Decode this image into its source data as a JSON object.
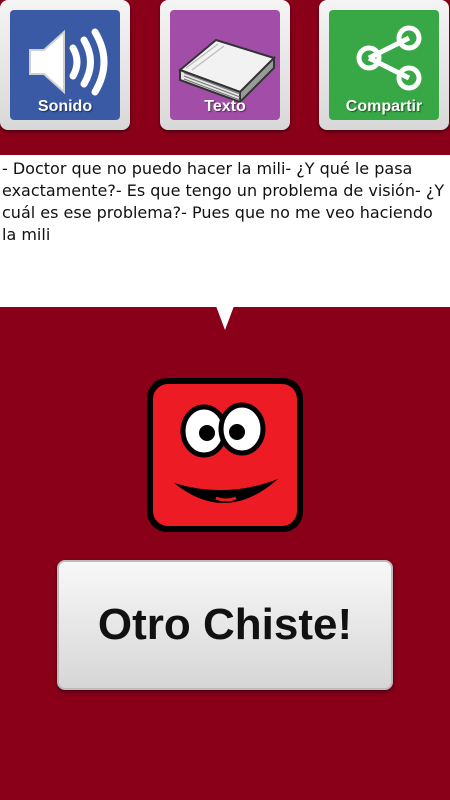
{
  "toolbar": {
    "sound_label": "Sonido",
    "text_label": "Texto",
    "share_label": "Compartir",
    "icons": {
      "sound": "speaker-icon",
      "text": "book-icon",
      "share": "share-icon"
    }
  },
  "joke": {
    "text": "- Doctor que no puedo hacer la mili- ¿Y qué le pasa exactamente?- Es que tengo un problema de visión- ¿Y cuál es ese problema?- Pues que no me veo haciendo la mili"
  },
  "action": {
    "next_joke_label": "Otro Chiste!"
  },
  "colors": {
    "background": "#8a0019",
    "sound_tile": "#3a5aa6",
    "text_tile": "#a24ea8",
    "share_tile": "#37a845",
    "mascot": "#ed1c24"
  }
}
